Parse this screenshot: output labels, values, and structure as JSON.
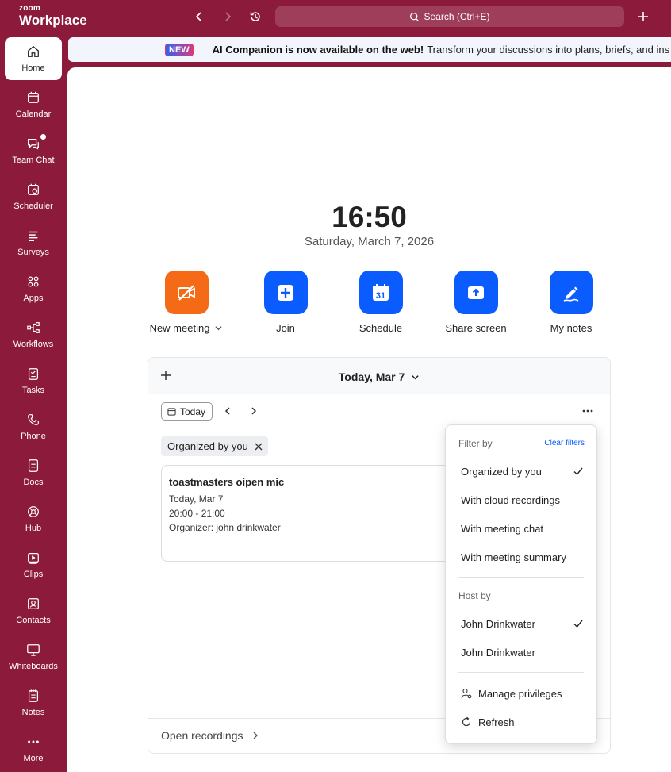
{
  "app": {
    "logo_line1": "zoom",
    "logo_line2": "Workplace"
  },
  "topbar": {
    "search_label": "Search (Ctrl+E)"
  },
  "sidebar": {
    "items": [
      {
        "label": "Home"
      },
      {
        "label": "Calendar"
      },
      {
        "label": "Team Chat"
      },
      {
        "label": "Scheduler"
      },
      {
        "label": "Surveys"
      },
      {
        "label": "Apps"
      },
      {
        "label": "Workflows"
      },
      {
        "label": "Tasks"
      },
      {
        "label": "Phone"
      },
      {
        "label": "Docs"
      },
      {
        "label": "Hub"
      },
      {
        "label": "Clips"
      },
      {
        "label": "Contacts"
      },
      {
        "label": "Whiteboards"
      },
      {
        "label": "Notes"
      },
      {
        "label": "More"
      }
    ]
  },
  "banner": {
    "badge": "NEW",
    "title": "AI Companion is now available on the web!",
    "text": "Transform your discussions into plans, briefs, and ins"
  },
  "home": {
    "time": "16:50",
    "date": "Saturday, March 7, 2026",
    "actions": {
      "new_meeting": "New meeting",
      "join": "Join",
      "schedule": "Schedule",
      "schedule_day": "31",
      "share_screen": "Share screen",
      "my_notes": "My notes"
    }
  },
  "calendar": {
    "header_title": "Today, Mar 7",
    "today_button": "Today",
    "filter_chip": "Organized by you",
    "meeting": {
      "title": "toastmasters oipen mic",
      "day": "Today, Mar 7",
      "time": "20:00 - 21:00",
      "organizer": "Organizer: john drinkwater"
    },
    "footer_link": "Open recordings"
  },
  "filter_menu": {
    "filter_by_label": "Filter by",
    "clear_filters": "Clear filters",
    "filters": [
      {
        "label": "Organized by you",
        "checked": true
      },
      {
        "label": "With cloud recordings",
        "checked": false
      },
      {
        "label": "With meeting chat",
        "checked": false
      },
      {
        "label": "With meeting summary",
        "checked": false
      }
    ],
    "host_by_label": "Host by",
    "hosts": [
      {
        "label": "John Drinkwater",
        "checked": true
      },
      {
        "label": "John Drinkwater",
        "checked": false
      }
    ],
    "manage_privileges": "Manage privileges",
    "refresh": "Refresh"
  },
  "colors": {
    "brand": "#8c1a3b",
    "accent": "#0b5cff",
    "orange": "#f56a16"
  }
}
